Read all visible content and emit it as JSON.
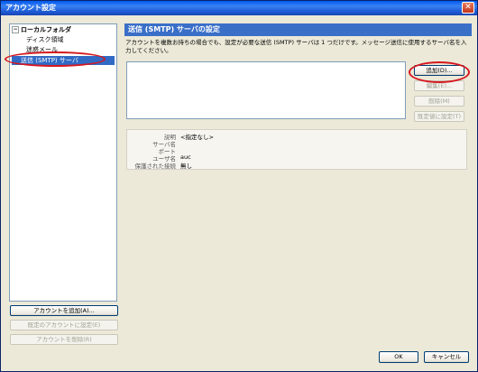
{
  "window": {
    "title": "アカウント設定",
    "close_glyph": "✕"
  },
  "tree": {
    "expander": "−",
    "items": [
      {
        "label": "ローカルフォルダ"
      },
      {
        "label": "ディスク領域"
      },
      {
        "label": "迷惑メール"
      },
      {
        "label": "送信 (SMTP) サーバ"
      }
    ]
  },
  "left_buttons": {
    "add_account": "アカウントを追加(A)...",
    "set_default": "既定のアカウントに設定(E)",
    "remove_account": "アカウントを削除(R)"
  },
  "panel": {
    "title": "送信 (SMTP) サーバの設定",
    "description": "アカウントを複数お持ちの場合でも、設定が必要な送信 (SMTP) サーバは 1 つだけです。メッセージ送信に使用するサーバ名を入力してください。"
  },
  "server_buttons": {
    "add": "追加(D)...",
    "edit": "編集(E)...",
    "delete": "削除(M)",
    "set_default": "既定値に設定(T)"
  },
  "details": {
    "description_label": "説明",
    "description_value": "<指定なし>",
    "server_label": "サーバ名",
    "server_value": "",
    "port_label": "ポート",
    "port_value": "",
    "username_label": "ユーザ名",
    "username_value": "auc",
    "security_label": "保護された接続",
    "security_value": "無し"
  },
  "footer": {
    "ok": "OK",
    "cancel": "キャンセル"
  }
}
